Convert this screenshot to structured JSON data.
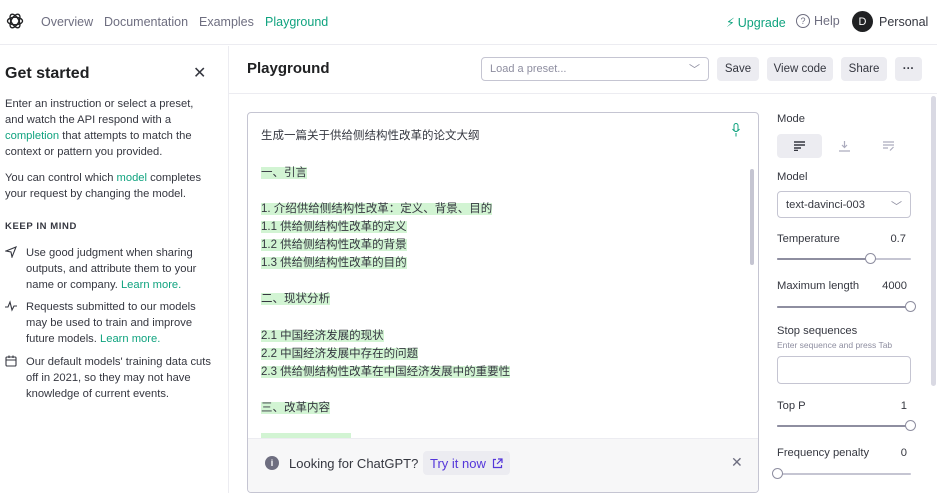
{
  "nav": {
    "links": [
      "Overview",
      "Documentation",
      "Examples",
      "Playground"
    ],
    "upgrade": "Upgrade",
    "help": "Help",
    "avatar_initial": "D",
    "account": "Personal",
    "accent": "#10a37f"
  },
  "sidebar": {
    "title": "Get started",
    "intro_pre": "Enter an instruction or select a preset, and watch the API respond with a ",
    "intro_link": "completion",
    "intro_post": " that attempts to match the context or pattern you provided.",
    "model_pre": "You can control which ",
    "model_link": "model",
    "model_post": " completes your request by changing the model.",
    "keep_in_mind": "KEEP IN MIND",
    "tips": [
      {
        "text": "Use good judgment when sharing outputs, and attribute them to your name or company. ",
        "link": "Learn more."
      },
      {
        "text": "Requests submitted to our models may be used to train and improve future models. ",
        "link": "Learn more."
      },
      {
        "text": "Our default models' training data cuts off in 2021, so they may not have knowledge of current events.",
        "link": ""
      }
    ]
  },
  "header": {
    "title": "Playground",
    "preset_placeholder": "Load a preset...",
    "save": "Save",
    "view_code": "View code",
    "share": "Share",
    "more": "···"
  },
  "editor": {
    "prompt": "生成一篇关于供给侧结构性改革的论文大纲",
    "lines": [
      "一、引言",
      "",
      "1. 介绍供给侧结构性改革：定义、背景、目的",
      "1.1 供给侧结构性改革的定义",
      "1.2 供给侧结构性改革的背景",
      "1.3 供给侧结构性改革的目的",
      "",
      "二、现状分析",
      "",
      "2.1 中国经济发展的现状",
      "2.2 中国经济发展中存在的问题",
      "2.3 供给侧结构性改革在中国经济发展中的重要性",
      "",
      "三、改革内容"
    ],
    "highlight_color": "#d2f4d3"
  },
  "banner": {
    "text": "Looking for ChatGPT?",
    "cta": "Try it now"
  },
  "settings": {
    "mode_label": "Mode",
    "model_label": "Model",
    "model_value": "text-davinci-003",
    "temperature_label": "Temperature",
    "temperature_value": "0.7",
    "temperature_fraction": 0.7,
    "max_length_label": "Maximum length",
    "max_length_value": "4000",
    "max_length_fraction": 1.0,
    "stop_label": "Stop sequences",
    "stop_hint": "Enter sequence and press Tab",
    "top_p_label": "Top P",
    "top_p_value": "1",
    "top_p_fraction": 1.0,
    "freq_label": "Frequency penalty",
    "freq_value": "0",
    "freq_fraction": 0.0
  }
}
